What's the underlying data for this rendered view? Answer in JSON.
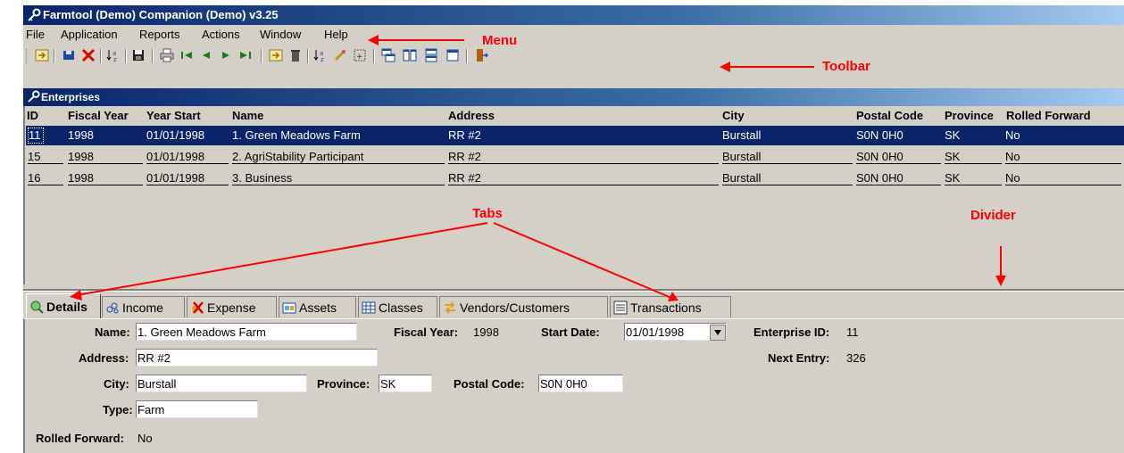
{
  "window": {
    "title": "Farmtool (Demo) Companion (Demo) v3.25"
  },
  "menu": {
    "items": [
      "File",
      "Application",
      "Reports",
      "Actions",
      "Window",
      "Help"
    ]
  },
  "subwindow": {
    "title": "Enterprises"
  },
  "grid": {
    "headers": [
      "ID",
      "Fiscal Year",
      "Year Start",
      "Name",
      "Address",
      "City",
      "Postal Code",
      "Province",
      "Rolled Forward"
    ],
    "rows": [
      {
        "id": "11",
        "fiscal_year": "1998",
        "year_start": "01/01/1998",
        "name": "1. Green Meadows Farm",
        "address": "RR #2",
        "city": "Burstall",
        "postal_code": "S0N 0H0",
        "province": "SK",
        "rolled_forward": "No"
      },
      {
        "id": "15",
        "fiscal_year": "1998",
        "year_start": "01/01/1998",
        "name": "2. AgriStability Participant",
        "address": "RR #2",
        "city": "Burstall",
        "postal_code": "S0N 0H0",
        "province": "SK",
        "rolled_forward": "No"
      },
      {
        "id": "16",
        "fiscal_year": "1998",
        "year_start": "01/01/1998",
        "name": "3. Business",
        "address": "RR #2",
        "city": "Burstall",
        "postal_code": "S0N 0H0",
        "province": "SK",
        "rolled_forward": "No"
      }
    ],
    "selected_index": 0
  },
  "tabs": [
    "Details",
    "Income",
    "Expense",
    "Assets",
    "Classes",
    "Vendors/Customers",
    "Transactions"
  ],
  "details": {
    "name_label": "Name:",
    "name_value": "1. Green Meadows Farm",
    "fiscal_year_label": "Fiscal Year:",
    "fiscal_year_value": "1998",
    "start_date_label": "Start Date:",
    "start_date_value": "01/01/1998",
    "enterprise_id_label": "Enterprise ID:",
    "enterprise_id_value": "11",
    "address_label": "Address:",
    "address_value": "RR #2",
    "next_entry_label": "Next Entry:",
    "next_entry_value": "326",
    "city_label": "City:",
    "city_value": "Burstall",
    "province_label": "Province:",
    "province_value": "SK",
    "postal_code_label": "Postal Code:",
    "postal_code_value": "S0N 0H0",
    "type_label": "Type:",
    "type_value": "Farm",
    "rolled_forward_label": "Rolled Forward:",
    "rolled_forward_value": "No"
  },
  "annotations": {
    "menu": "Menu",
    "toolbar": "Toolbar",
    "tabs": "Tabs",
    "divider": "Divider"
  },
  "colors": {
    "title_bar": "#0a246a",
    "selection": "#0a246a",
    "face": "#d4d0c8",
    "annotation": "#ff0000"
  },
  "toolbar_icons": [
    "open-icon",
    "save-icon",
    "delete-icon",
    "sort-icon",
    "disk-icon",
    "print-icon",
    "first-record-icon",
    "prev-record-icon",
    "next-record-icon",
    "last-record-icon",
    "import-icon",
    "trash-icon",
    "sort-az-icon",
    "filter-icon",
    "find-icon",
    "cascade-icon",
    "tile-vertical-icon",
    "tile-horizontal-icon",
    "window-icon",
    "exit-icon"
  ]
}
